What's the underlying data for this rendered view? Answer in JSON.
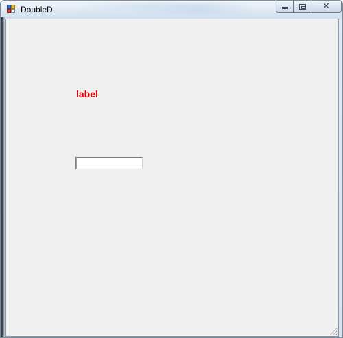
{
  "window": {
    "title": "DoubleD",
    "icon": "app-icon",
    "caption_buttons": {
      "minimize": "minimize-icon",
      "maximize": "maximize-icon",
      "close": "close-icon",
      "close_glyph": "✕"
    }
  },
  "form": {
    "label_text": "label",
    "label_color": "#e00000",
    "textbox_value": "",
    "background_color": "#f0f0f0"
  }
}
